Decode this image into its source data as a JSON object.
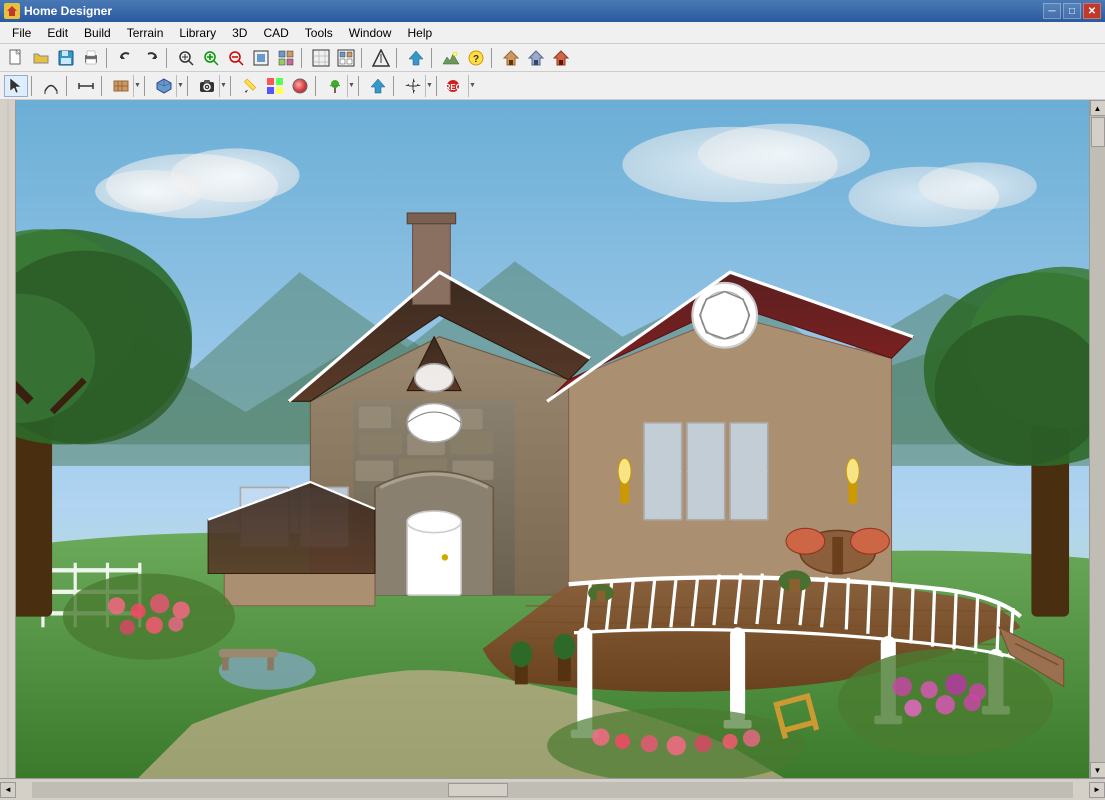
{
  "titlebar": {
    "title": "Home Designer",
    "icon_label": "HD",
    "minimize_label": "─",
    "maximize_label": "□",
    "close_label": "✕"
  },
  "menubar": {
    "items": [
      {
        "id": "file",
        "label": "File"
      },
      {
        "id": "edit",
        "label": "Edit"
      },
      {
        "id": "build",
        "label": "Build"
      },
      {
        "id": "terrain",
        "label": "Terrain"
      },
      {
        "id": "library",
        "label": "Library"
      },
      {
        "id": "3d",
        "label": "3D"
      },
      {
        "id": "cad",
        "label": "CAD"
      },
      {
        "id": "tools",
        "label": "Tools"
      },
      {
        "id": "window",
        "label": "Window"
      },
      {
        "id": "help",
        "label": "Help"
      }
    ]
  },
  "toolbar1": {
    "buttons": [
      {
        "id": "new",
        "icon": "📄",
        "label": "New"
      },
      {
        "id": "open",
        "icon": "📂",
        "label": "Open"
      },
      {
        "id": "save",
        "icon": "💾",
        "label": "Save"
      },
      {
        "id": "print",
        "icon": "🖨",
        "label": "Print"
      },
      {
        "id": "sep1",
        "type": "sep"
      },
      {
        "id": "undo",
        "icon": "↩",
        "label": "Undo"
      },
      {
        "id": "redo",
        "icon": "↪",
        "label": "Redo"
      },
      {
        "id": "sep2",
        "type": "sep"
      },
      {
        "id": "zoom-in-glass",
        "icon": "🔍",
        "label": "Zoom"
      },
      {
        "id": "zoom-in",
        "icon": "⊕",
        "label": "Zoom In"
      },
      {
        "id": "zoom-out",
        "icon": "⊖",
        "label": "Zoom Out"
      },
      {
        "id": "fit",
        "icon": "⊞",
        "label": "Fit"
      },
      {
        "id": "fit2",
        "icon": "⊡",
        "label": "Fit All"
      },
      {
        "id": "sep3",
        "type": "sep"
      },
      {
        "id": "snap",
        "icon": "⊞",
        "label": "Snap"
      },
      {
        "id": "sep4",
        "type": "sep"
      },
      {
        "id": "arrow-up",
        "icon": "↑",
        "label": "Arrow"
      },
      {
        "id": "sep5",
        "type": "sep"
      },
      {
        "id": "elevation",
        "icon": "⛰",
        "label": "Elevation"
      },
      {
        "id": "help-btn",
        "icon": "?",
        "label": "Help"
      },
      {
        "id": "sep6",
        "type": "sep"
      },
      {
        "id": "house1",
        "icon": "🏠",
        "label": "House1"
      },
      {
        "id": "house2",
        "icon": "🏡",
        "label": "House2"
      },
      {
        "id": "house3",
        "icon": "🏘",
        "label": "House3"
      }
    ]
  },
  "toolbar2": {
    "buttons": [
      {
        "id": "select",
        "icon": "↖",
        "label": "Select"
      },
      {
        "id": "sep1",
        "type": "sep"
      },
      {
        "id": "draw-line",
        "icon": "╱",
        "label": "Draw Line"
      },
      {
        "id": "sep2",
        "type": "sep"
      },
      {
        "id": "measure",
        "icon": "⊢",
        "label": "Measure"
      },
      {
        "id": "sep3",
        "type": "sep"
      },
      {
        "id": "wall",
        "icon": "▦",
        "label": "Wall"
      },
      {
        "id": "sep4",
        "type": "sep"
      },
      {
        "id": "obj3d",
        "icon": "◫",
        "label": "3D Object"
      },
      {
        "id": "sep5",
        "type": "sep"
      },
      {
        "id": "camera",
        "icon": "📷",
        "label": "Camera"
      },
      {
        "id": "sep6",
        "type": "sep"
      },
      {
        "id": "paint",
        "icon": "✏",
        "label": "Paint"
      },
      {
        "id": "color",
        "icon": "🎨",
        "label": "Color"
      },
      {
        "id": "texture",
        "icon": "◈",
        "label": "Texture"
      },
      {
        "id": "sep7",
        "type": "sep"
      },
      {
        "id": "plant",
        "icon": "🌿",
        "label": "Plant"
      },
      {
        "id": "sep8",
        "type": "sep"
      },
      {
        "id": "up-arrow",
        "icon": "⬆",
        "label": "Up"
      },
      {
        "id": "sep9",
        "type": "sep"
      },
      {
        "id": "move",
        "icon": "✛",
        "label": "Move"
      },
      {
        "id": "sep10",
        "type": "sep"
      },
      {
        "id": "record",
        "icon": "⏺",
        "label": "Record"
      }
    ]
  },
  "scene": {
    "background_sky": "#87CEEB",
    "background_ground": "#4a7a3a",
    "description": "3D house rendering with deck and garden"
  },
  "scrollbars": {
    "v_up": "▲",
    "v_down": "▼",
    "h_left": "◄",
    "h_right": "►"
  },
  "statusbar": {
    "text": ""
  }
}
